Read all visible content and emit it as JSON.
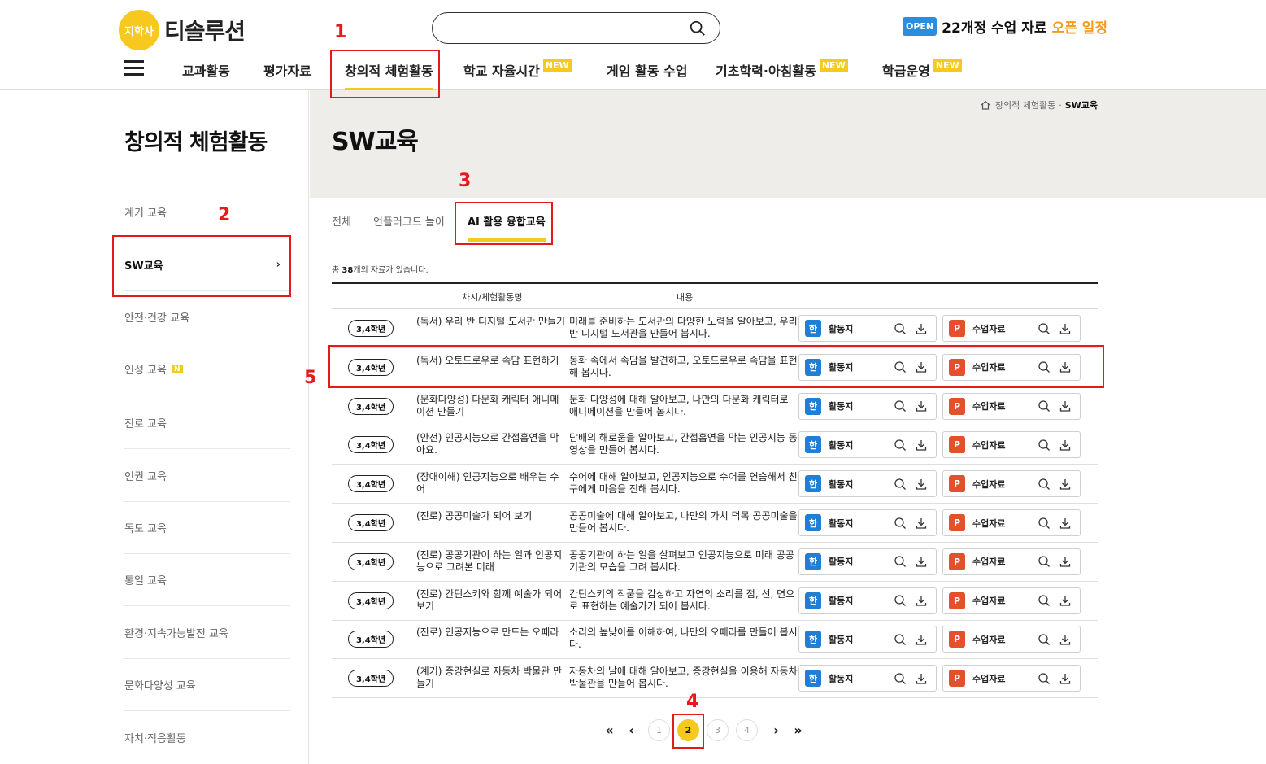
{
  "header": {
    "logo_badge": "지학사",
    "logo_text": "티솔루션",
    "search_placeholder": "",
    "open_badge": "OPEN",
    "open_text": "22개정 수업 자료",
    "open_highlight": "오픈 일정"
  },
  "gnb": {
    "items": [
      {
        "label": "교과활동",
        "new": ""
      },
      {
        "label": "평가자료",
        "new": ""
      },
      {
        "label": "창의적 체험활동",
        "new": ""
      },
      {
        "label": "학교 자율시간",
        "new": "NEW"
      },
      {
        "label": "게임 활동 수업",
        "new": ""
      },
      {
        "label": "기초학력·아침활동",
        "new": "NEW"
      },
      {
        "label": "학급운영",
        "new": "NEW"
      }
    ]
  },
  "sidebar": {
    "title": "창의적 체험활동",
    "items": [
      {
        "label": "계기 교육",
        "badge": ""
      },
      {
        "label": "SW교육",
        "badge": ""
      },
      {
        "label": "안전·건강 교육",
        "badge": ""
      },
      {
        "label": "인성 교육",
        "badge": "N"
      },
      {
        "label": "진로 교육",
        "badge": ""
      },
      {
        "label": "인권 교육",
        "badge": ""
      },
      {
        "label": "독도 교육",
        "badge": ""
      },
      {
        "label": "통일 교육",
        "badge": ""
      },
      {
        "label": "환경·지속가능발전 교육",
        "badge": ""
      },
      {
        "label": "문화다양성 교육",
        "badge": ""
      },
      {
        "label": "자치·적응활동",
        "badge": ""
      }
    ],
    "chevron": "›"
  },
  "breadcrumb": {
    "parent": "창의적 체험활동",
    "sep": "·",
    "current": "SW교육"
  },
  "page_title": "SW교육",
  "tabs": [
    "전체",
    "언플러그드 놀이",
    "AI 활용 융합교육"
  ],
  "count": {
    "prefix": "총 ",
    "number": "38",
    "suffix": "개의 자료가 있습니다."
  },
  "table": {
    "headers": {
      "name": "차시/체험활동명",
      "desc": "내용"
    },
    "activity_label": "활동지",
    "lesson_label": "수업자료",
    "activity_icon": "한",
    "lesson_icon": "P",
    "rows": [
      {
        "grade": "3,4학년",
        "name": "(독서) 우리 반 디지털 도서관 만들기",
        "desc": "미래를 준비하는 도서관의 다양한 노력을 알아보고, 우리 반 디지털 도서관을 만들어 봅시다."
      },
      {
        "grade": "3,4학년",
        "name": "(독서) 오토드로우로 속담 표현하기",
        "desc": "동화 속에서 속담을 발견하고, 오토드로우로 속담을 표현해 봅시다."
      },
      {
        "grade": "3,4학년",
        "name": "(문화다양성) 다문화 캐릭터 애니메이션 만들기",
        "desc": "문화 다양성에 대해 알아보고, 나만의 다문화 캐릭터로 애니메이션을 만들어 봅시다."
      },
      {
        "grade": "3,4학년",
        "name": "(안전) 인공지능으로 간접흡연을 막아요.",
        "desc": "담배의 해로움을 알아보고, 간접흡연을 막는 인공지능 동영상을 만들어 봅시다."
      },
      {
        "grade": "3,4학년",
        "name": "(장애이해) 인공지능으로 배우는 수어",
        "desc": "수어에 대해 알아보고, 인공지능으로 수어를 연습해서 친구에게 마음을 전해 봅시다."
      },
      {
        "grade": "3,4학년",
        "name": "(진로) 공공미술가 되어 보기",
        "desc": "공공미술에 대해 알아보고, 나만의 가치 덕목 공공미술을 만들어 봅시다."
      },
      {
        "grade": "3,4학년",
        "name": "(진로) 공공기관이 하는 일과 인공지능으로 그려본 미래",
        "desc": "공공기관이 하는 일을 살펴보고 인공지능으로 미래 공공기관의 모습을 그려 봅시다."
      },
      {
        "grade": "3,4학년",
        "name": "(진로) 칸딘스키와 함께 예술가 되어 보기",
        "desc": "칸딘스키의 작품을 감상하고 자연의 소리를 점, 선, 면으로 표현하는 예술가가 되어 봅시다."
      },
      {
        "grade": "3,4학년",
        "name": "(진로) 인공지능으로 만드는 오페라",
        "desc": "소리의 높낮이를 이해하여, 나만의 오페라를 만들어 봅시다."
      },
      {
        "grade": "3,4학년",
        "name": "(계기) 증강현실로 자동차 박물관 만들기",
        "desc": "자동차의 날에 대해 알아보고, 증강현실을 이용해 자동차 박물관을 만들어 봅시다."
      }
    ]
  },
  "pagination": {
    "first": "«",
    "prev": "‹",
    "pages": [
      "1",
      "2",
      "3",
      "4"
    ],
    "current": "2",
    "next": "›",
    "last": "»"
  },
  "annotations": [
    "1",
    "2",
    "3",
    "4",
    "5"
  ],
  "colors": {
    "accent": "#f7c81e",
    "annotation": "#e51b1b",
    "band": "#efedea"
  }
}
